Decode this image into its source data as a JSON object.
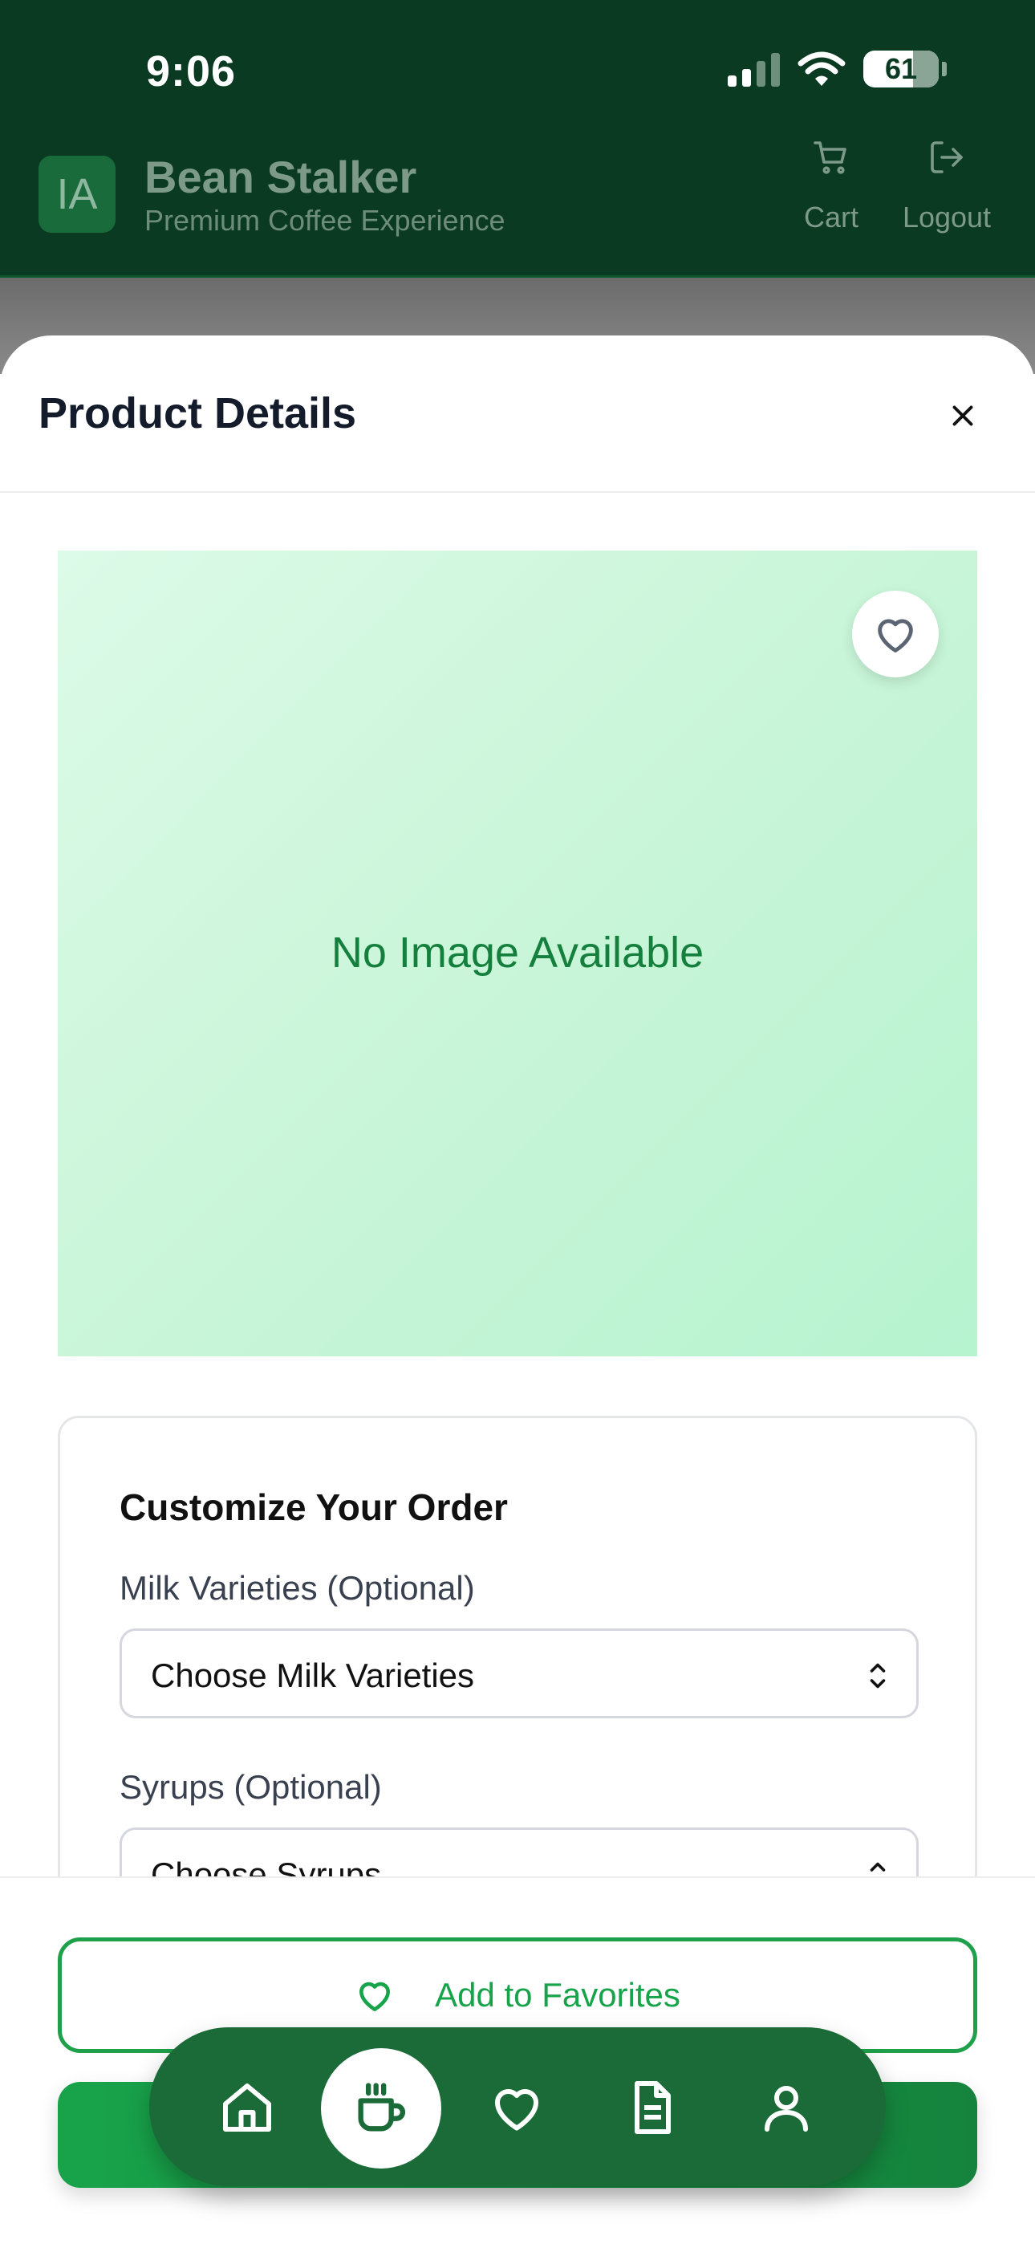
{
  "status_bar": {
    "time": "9:06",
    "battery_level": "61"
  },
  "app_header": {
    "badge_initials": "IA",
    "title": "Bean Stalker",
    "subtitle": "Premium Coffee Experience",
    "cart_label": "Cart",
    "logout_label": "Logout"
  },
  "modal": {
    "title": "Product Details",
    "image_placeholder": "No Image Available",
    "customize": {
      "heading": "Customize Your Order",
      "milk_label": "Milk Varieties (Optional)",
      "milk_value": "Choose Milk Varieties",
      "syrups_label": "Syrups (Optional)",
      "syrups_value": "Choose Syrups"
    },
    "favorites_button": "Add to Favorites"
  },
  "bottom_nav": {
    "items": [
      {
        "icon": "home-icon",
        "active": false
      },
      {
        "icon": "coffee-cup-icon",
        "active": true
      },
      {
        "icon": "heart-icon",
        "active": false
      },
      {
        "icon": "document-icon",
        "active": false
      },
      {
        "icon": "user-icon",
        "active": false
      }
    ]
  },
  "colors": {
    "header_bg": "#0a3a22",
    "brand_green": "#16a34a",
    "nav_bg": "#1a6b38",
    "image_bg": "#c9f5d8"
  }
}
